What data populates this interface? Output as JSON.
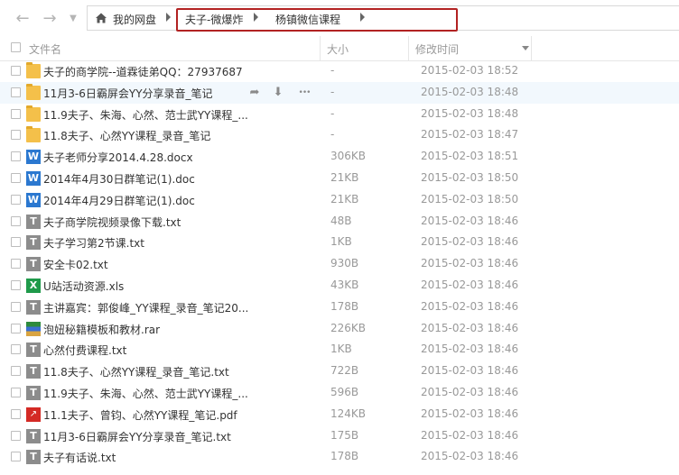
{
  "nav": {
    "back_icon": "arrow-left-icon",
    "forward_icon": "arrow-right-icon",
    "history_icon": "chevron-down-icon"
  },
  "breadcrumb": {
    "root": "我的网盘",
    "items": [
      "夫子-微爆炸",
      "杨镇微信课程"
    ]
  },
  "columns": {
    "name": "文件名",
    "size": "大小",
    "modified": "修改时间"
  },
  "files": [
    {
      "name": "夫子的商学院--道霖徒弟QQ：27937687",
      "size": "-",
      "date": "2015-02-03 18:52",
      "type": "folder"
    },
    {
      "name": "11月3-6日霸屏会YY分享录音_笔记",
      "size": "-",
      "date": "2015-02-03 18:48",
      "type": "folder",
      "hover": true
    },
    {
      "name": "11.9夫子、朱海、心然、范士武YY课程_...",
      "size": "-",
      "date": "2015-02-03 18:48",
      "type": "folder"
    },
    {
      "name": "11.8夫子、心然YY课程_录音_笔记",
      "size": "-",
      "date": "2015-02-03 18:47",
      "type": "folder"
    },
    {
      "name": "夫子老师分享2014.4.28.docx",
      "size": "306KB",
      "date": "2015-02-03 18:51",
      "type": "word"
    },
    {
      "name": "2014年4月30日群笔记(1).doc",
      "size": "21KB",
      "date": "2015-02-03 18:50",
      "type": "word"
    },
    {
      "name": "2014年4月29日群笔记(1).doc",
      "size": "21KB",
      "date": "2015-02-03 18:50",
      "type": "word"
    },
    {
      "name": "夫子商学院视频录像下载.txt",
      "size": "48B",
      "date": "2015-02-03 18:46",
      "type": "txt"
    },
    {
      "name": "夫子学习第2节课.txt",
      "size": "1KB",
      "date": "2015-02-03 18:46",
      "type": "txt"
    },
    {
      "name": "安全卡02.txt",
      "size": "930B",
      "date": "2015-02-03 18:46",
      "type": "txt"
    },
    {
      "name": "U站活动资源.xls",
      "size": "43KB",
      "date": "2015-02-03 18:46",
      "type": "xls"
    },
    {
      "name": "主讲嘉宾：郭俊峰_YY课程_录音_笔记20...",
      "size": "178B",
      "date": "2015-02-03 18:46",
      "type": "txt"
    },
    {
      "name": "泡妞秘籍模板和教材.rar",
      "size": "226KB",
      "date": "2015-02-03 18:46",
      "type": "rar"
    },
    {
      "name": "心然付费课程.txt",
      "size": "1KB",
      "date": "2015-02-03 18:46",
      "type": "txt"
    },
    {
      "name": "11.8夫子、心然YY课程_录音_笔记.txt",
      "size": "722B",
      "date": "2015-02-03 18:46",
      "type": "txt"
    },
    {
      "name": "11.9夫子、朱海、心然、范士武YY课程_...",
      "size": "596B",
      "date": "2015-02-03 18:46",
      "type": "txt"
    },
    {
      "name": "11.1夫子、曾钧、心然YY课程_笔记.pdf",
      "size": "124KB",
      "date": "2015-02-03 18:46",
      "type": "pdf"
    },
    {
      "name": "11月3-6日霸屏会YY分享录音_笔记.txt",
      "size": "175B",
      "date": "2015-02-03 18:46",
      "type": "txt"
    },
    {
      "name": "夫子有话说.txt",
      "size": "178B",
      "date": "2015-02-03 18:46",
      "type": "txt"
    }
  ],
  "row_actions": {
    "share": "share-icon",
    "download": "download-icon",
    "more": "more-icon"
  },
  "colors": {
    "highlight_border": "#b22222",
    "hover_row": "#f2f8fd"
  }
}
